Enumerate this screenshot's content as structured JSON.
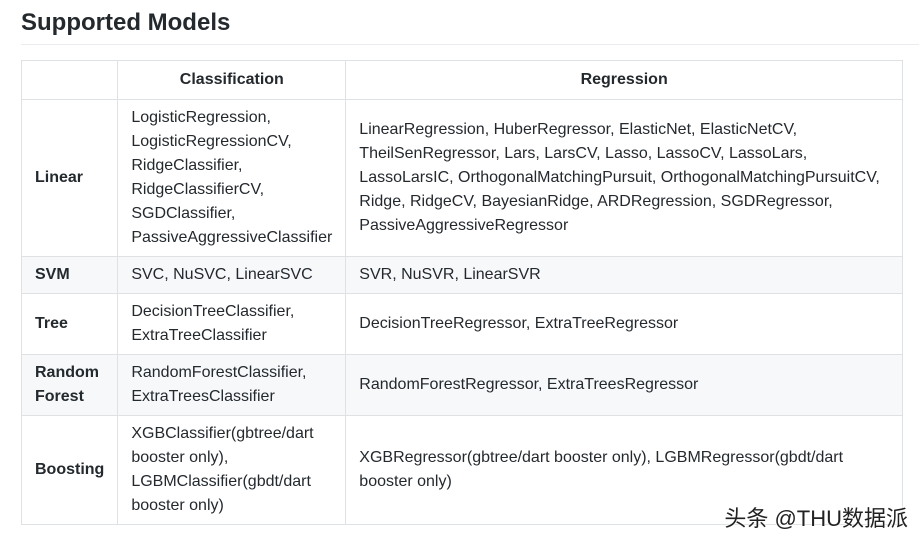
{
  "page": {
    "title": "Supported Models"
  },
  "table": {
    "headers": [
      "",
      "Classification",
      "Regression"
    ],
    "rows": [
      {
        "category": "Linear",
        "classification": [
          "LogisticRegression,",
          "LogisticRegressionCV,",
          "RidgeClassifier,",
          "RidgeClassifierCV,",
          "SGDClassifier,",
          "PassiveAggressiveClassifier"
        ],
        "regression": [
          "LinearRegression, HuberRegressor, ElasticNet, ElasticNetCV,",
          "TheilSenRegressor, Lars, LarsCV, Lasso, LassoCV, LassoLars,",
          "LassoLarsIC, OrthogonalMatchingPursuit, OrthogonalMatchingPursuitCV,",
          "Ridge, RidgeCV, BayesianRidge, ARDRegression, SGDRegressor,",
          "PassiveAggressiveRegressor"
        ]
      },
      {
        "category": "SVM",
        "classification": [
          "SVC, NuSVC, LinearSVC"
        ],
        "regression": [
          "SVR, NuSVR, LinearSVR"
        ]
      },
      {
        "category": "Tree",
        "classification": [
          "DecisionTreeClassifier,",
          "ExtraTreeClassifier"
        ],
        "regression": [
          "DecisionTreeRegressor, ExtraTreeRegressor"
        ]
      },
      {
        "category": "Random Forest",
        "category_lines": [
          "Random",
          "Forest"
        ],
        "classification": [
          "RandomForestClassifier,",
          "ExtraTreesClassifier"
        ],
        "regression": [
          "RandomForestRegressor, ExtraTreesRegressor"
        ]
      },
      {
        "category": "Boosting",
        "classification": [
          "XGBClassifier(gbtree/dart",
          "booster only),",
          "LGBMClassifier(gbdt/dart",
          "booster only)"
        ],
        "regression": [
          "XGBRegressor(gbtree/dart booster only), LGBMRegressor(gbdt/dart",
          "booster only)"
        ]
      }
    ]
  },
  "watermark": {
    "text": "头条 @THU数据派"
  }
}
